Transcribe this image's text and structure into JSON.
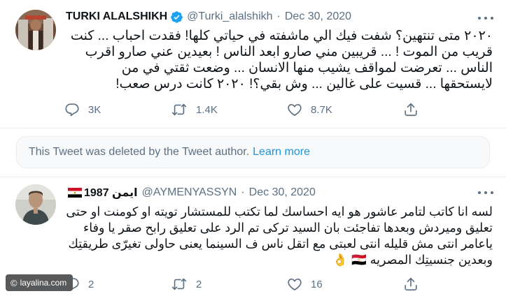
{
  "tweets": [
    {
      "display_name": "TURKI ALALSHIKH",
      "handle": "@Turki_alalshikh",
      "separator": "·",
      "date": "Dec 30, 2020",
      "text": "٢٠٢٠ متى تنتهين؟ شفت فيك الي ماشفته في حياتي كلها! فقدت احباب ... كنت قريب من الموت ! ... قريبين مني صارو ابعد الناس ! بعيدين عني صارو اقرب الناس ... تعرضت لمواقف يشيب منها الانسان ... وضعت ثقتي في من لايستحقها ... قسيت على غالين ... وش بقي؟! ٢٠٢٠ كانت درس صعب!",
      "actions": {
        "replies": "3K",
        "retweets": "1.4K",
        "likes": "8.7K"
      },
      "icons": {
        "verified": "verified-badge-icon",
        "more": "more-icon"
      }
    },
    {
      "display_name": "ايمن 1987",
      "handle": "@AYMENYASSYN",
      "separator": "·",
      "date": "Dec 30, 2020",
      "text": "لسه انا كاتب لتامر عاشور هو ايه احساسك لما تكتب للمستشار تويته او كومنت او حتى تعليق وميردش وبعدها تفاجئت بان السيد تركى تم الرد على تعليق رابح صقر يا وفاء ياعامر انتى مش قليله انتى لعبتى مع اتقل ناس ف السينما يعنى حاولى تغيرّى طريقتِك وبعدين جنسيتِك المصريه 🇪🇬 👌",
      "actions": {
        "replies": "2",
        "retweets": "2",
        "likes": "16"
      }
    }
  ],
  "deleted_notice": {
    "text": "This Tweet was deleted by the Tweet author.",
    "link": "Learn more"
  },
  "watermark": {
    "symbol": "©",
    "text": "layalina.com"
  },
  "colors": {
    "accent": "#1b95e0",
    "muted": "#5b7083",
    "text": "#0f1419",
    "verified": "#1da1f2"
  }
}
